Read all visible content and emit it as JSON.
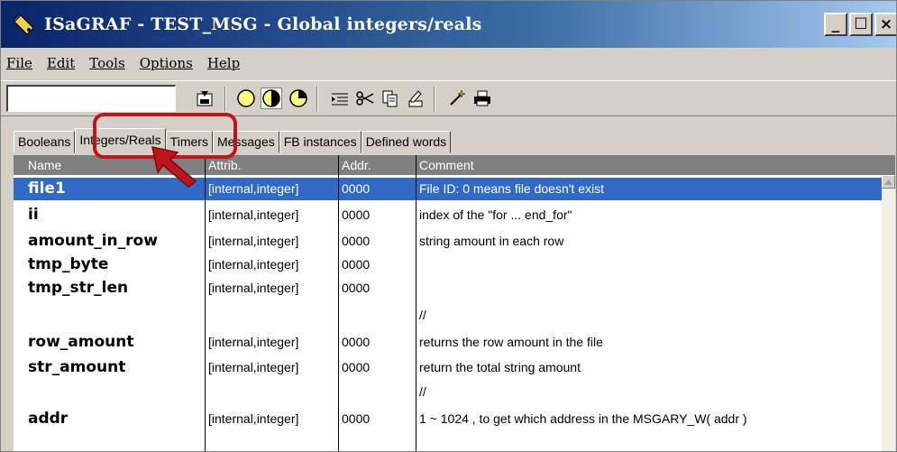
{
  "window": {
    "title": "ISaGRAF - TEST_MSG - Global integers/reals",
    "minimize_label": "_",
    "maximize_label": "☐",
    "close_label": "×"
  },
  "menu": [
    {
      "label": "File"
    },
    {
      "label": "Edit"
    },
    {
      "label": "Tools"
    },
    {
      "label": "Options"
    },
    {
      "label": "Help"
    }
  ],
  "toolbar": {
    "search_value": "",
    "icons": [
      "save-icon",
      "circle-empty-icon",
      "circle-half-icon",
      "circle-clock-icon",
      "list-indent-icon",
      "scissors-icon",
      "copy-icon",
      "paste-icon",
      "magic-wand-icon",
      "print-icon"
    ]
  },
  "tabs": [
    {
      "label": "Booleans",
      "active": false
    },
    {
      "label": "Integers/Reals",
      "active": true
    },
    {
      "label": "Timers",
      "active": false
    },
    {
      "label": "Messages",
      "active": false
    },
    {
      "label": "FB instances",
      "active": false
    },
    {
      "label": "Defined words",
      "active": false
    }
  ],
  "grid": {
    "columns": [
      "Name",
      "Attrib.",
      "Addr.",
      "Comment"
    ],
    "rows": [
      {
        "name": "file1",
        "attrib": "[internal,integer]",
        "addr": "0000",
        "comment": "File ID:  0 means file doesn't exist",
        "selected": true
      },
      {
        "name": "ii",
        "attrib": "[internal,integer]",
        "addr": "0000",
        "comment": "index of the \"for  ...  end_for\""
      },
      {
        "name": "amount_in_row",
        "attrib": "[internal,integer]",
        "addr": "0000",
        "comment": "string amount in each row"
      },
      {
        "name": "tmp_byte",
        "attrib": "[internal,integer]",
        "addr": "0000",
        "comment": ""
      },
      {
        "name": "tmp_str_len",
        "attrib": "[internal,integer]",
        "addr": "0000",
        "comment": ""
      },
      {
        "name": "",
        "attrib": "",
        "addr": "",
        "comment": "//"
      },
      {
        "name": "row_amount",
        "attrib": "[internal,integer]",
        "addr": "0000",
        "comment": "returns the row amount in the file"
      },
      {
        "name": "str_amount",
        "attrib": "[internal,integer]",
        "addr": "0000",
        "comment": "return the total string amount"
      },
      {
        "name": "",
        "attrib": "",
        "addr": "",
        "comment": "//"
      },
      {
        "name": "addr",
        "attrib": "[internal,integer]",
        "addr": "0000",
        "comment": "1 ~ 1024 , to get which address in the MSGARY_W( addr )"
      }
    ]
  },
  "colors": {
    "selection": "#3169c6",
    "highlight": "#c0161a",
    "header_bg": "#808080"
  }
}
